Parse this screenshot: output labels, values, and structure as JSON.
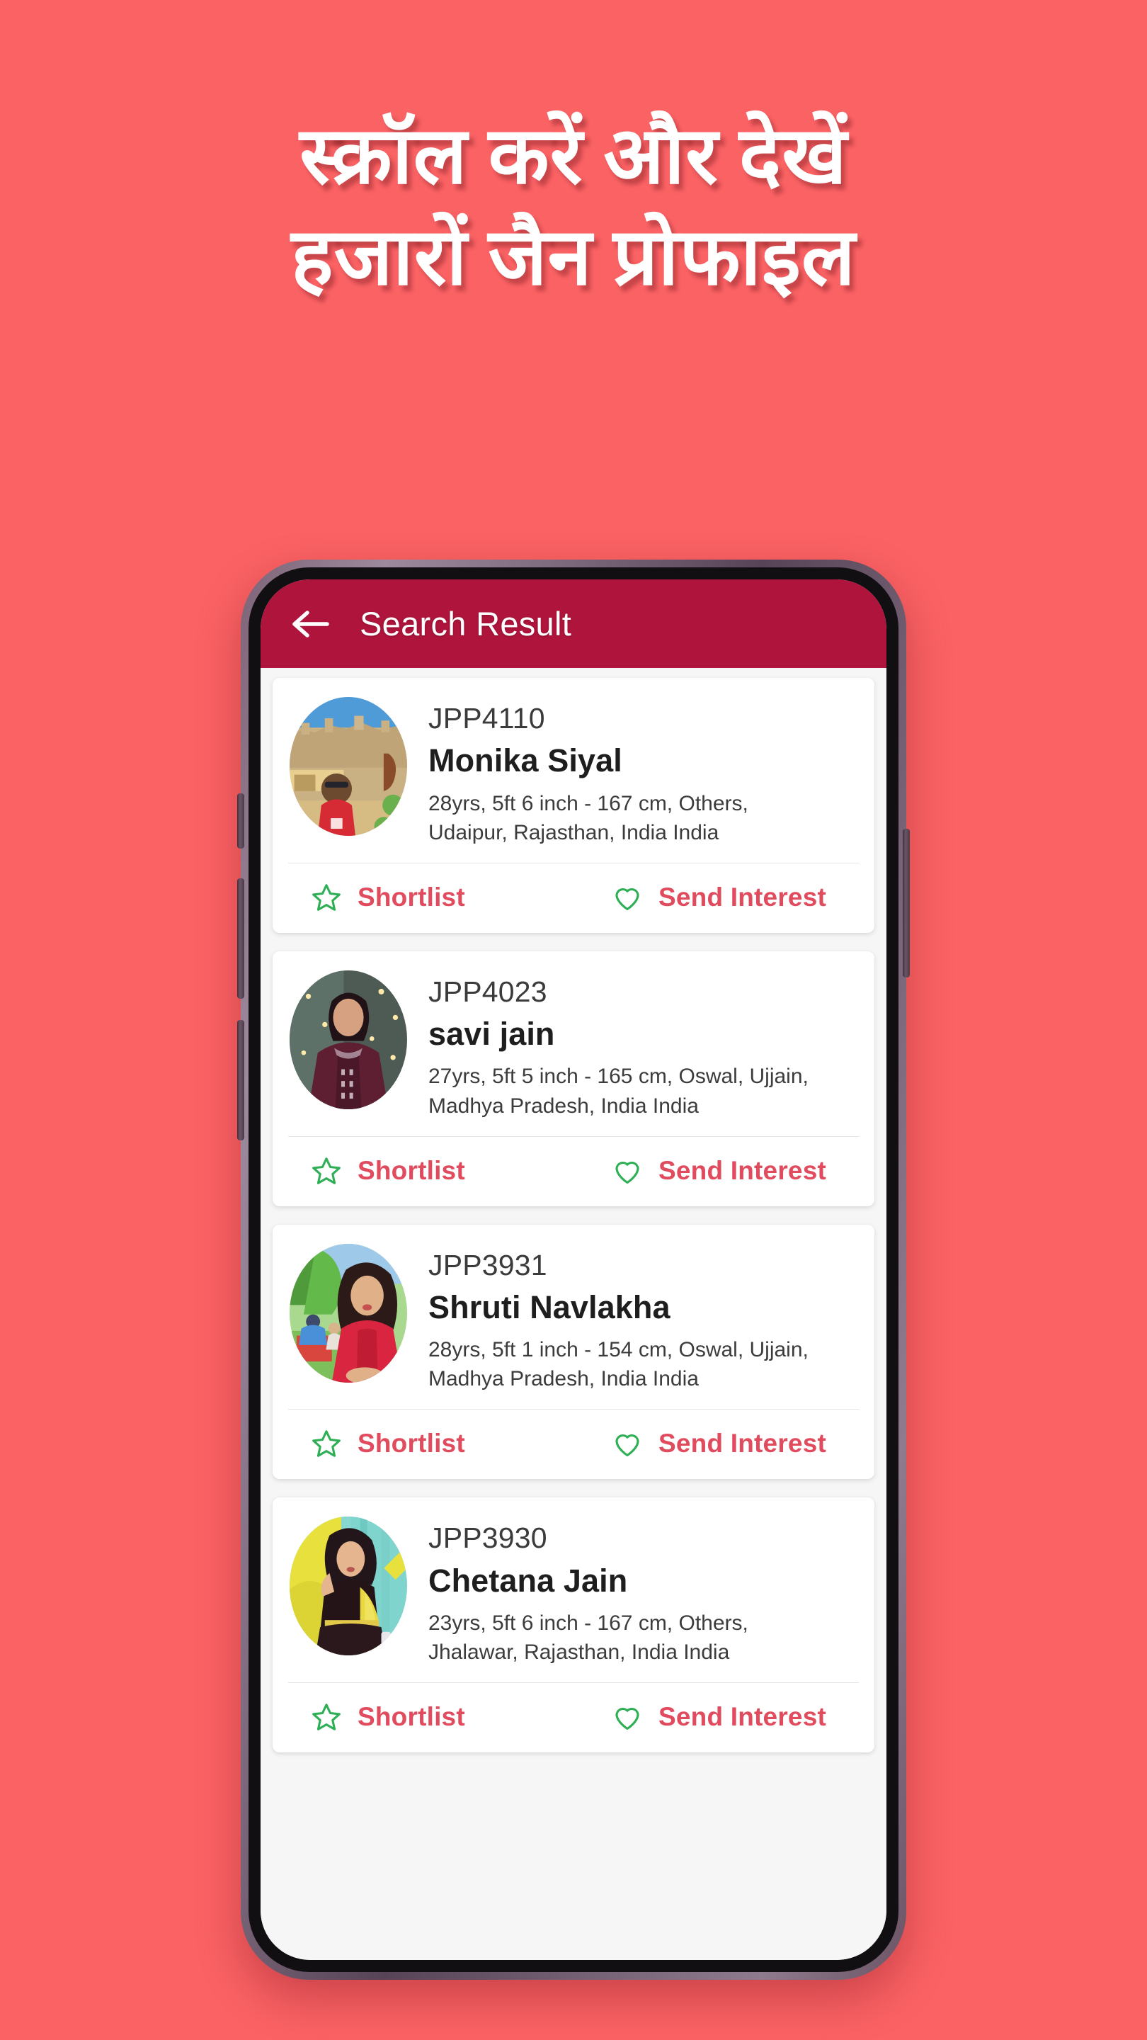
{
  "banner": {
    "background_color": "#fa6264",
    "headline_lines": [
      "स्क्रॉल करें और देखें",
      "हजारों जैन प्रोफाइल"
    ]
  },
  "theme": {
    "appbar_color": "#af143c",
    "accent_red": "#e14b5e",
    "icon_green": "#2faf55",
    "screen_bg": "#f6f6f6",
    "card_bg": "#ffffff"
  },
  "appbar": {
    "back_icon": "arrow-left-icon",
    "title": "Search Result"
  },
  "actions": {
    "shortlist": {
      "icon": "star-outline-icon",
      "label": "Shortlist"
    },
    "send_interest": {
      "icon": "heart-outline-icon",
      "label": "Send Interest"
    }
  },
  "profiles": [
    {
      "id": "JPP4110",
      "name": "Monika Siyal",
      "detail_line1": "28yrs, 5ft 6 inch - 167 cm, Others,",
      "detail_line2": "Udaipur, Rajasthan, India India",
      "avatar": "fort-desert-photo"
    },
    {
      "id": "JPP4023",
      "name": "savi jain",
      "detail_line1": "27yrs, 5ft 5 inch - 165 cm, Oswal, Ujjain,",
      "detail_line2": "Madhya Pradesh, India India",
      "avatar": "maroon-dress-lights-photo"
    },
    {
      "id": "JPP3931",
      "name": "Shruti Navlakha",
      "detail_line1": "28yrs, 5ft 1 inch - 154 cm, Oswal, Ujjain,",
      "detail_line2": "Madhya Pradesh, India India",
      "avatar": "red-kurti-park-photo"
    },
    {
      "id": "JPP3930",
      "name": "Chetana Jain",
      "detail_line1": "23yrs, 5ft 6 inch - 167 cm, Others,",
      "detail_line2": "Jhalawar, Rajasthan, India India",
      "avatar": "yellow-dupatta-photo"
    }
  ]
}
